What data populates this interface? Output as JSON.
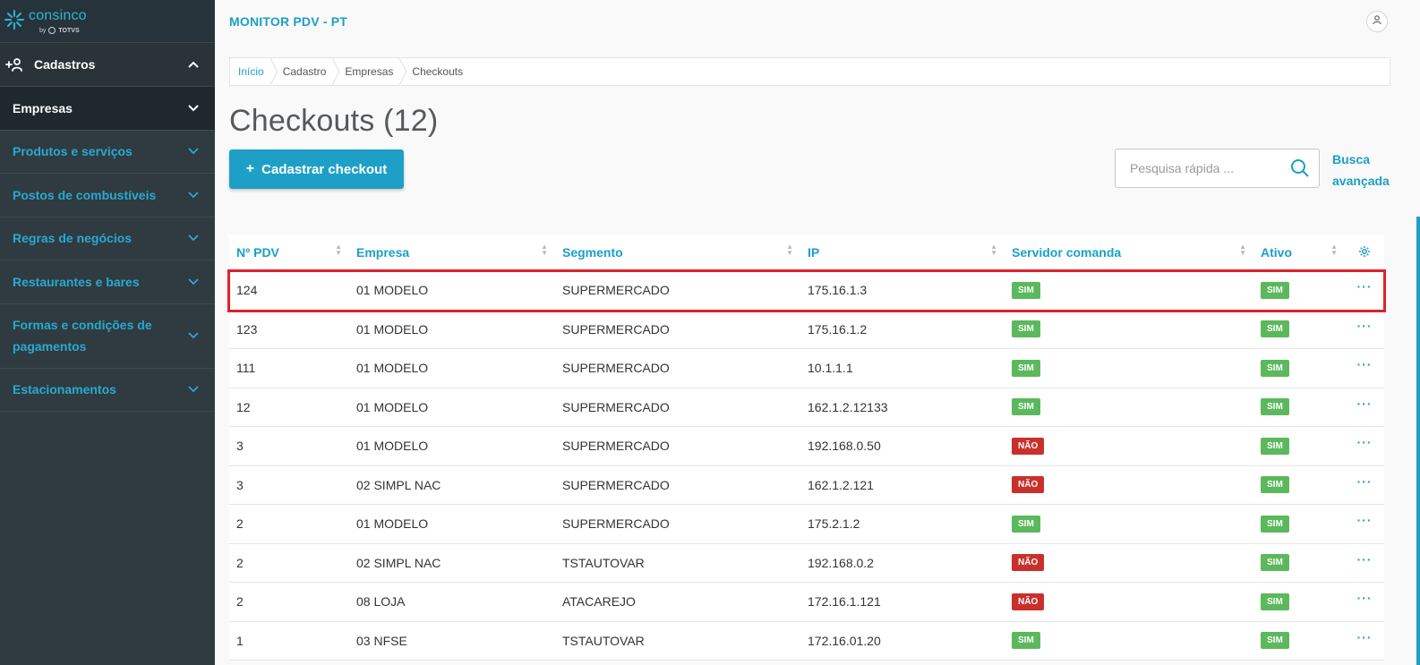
{
  "brand": {
    "name": "consinco",
    "by": "by",
    "partner": "TOTVS"
  },
  "sidebar": {
    "group": {
      "label": "Cadastros"
    },
    "items": [
      {
        "label": "Empresas",
        "active": true
      },
      {
        "label": "Produtos e serviços"
      },
      {
        "label": "Postos de combustíveis"
      },
      {
        "label": "Regras de negócios"
      },
      {
        "label": "Restaurantes e bares"
      },
      {
        "label": "Formas e condições de pagamentos"
      },
      {
        "label": "Estacionamentos"
      }
    ]
  },
  "header": {
    "app_title": "MONITOR PDV - PT"
  },
  "breadcrumb": [
    "Início",
    "Cadastro",
    "Empresas",
    "Checkouts"
  ],
  "page": {
    "title": "Checkouts (12)"
  },
  "actions": {
    "add_label": "Cadastrar checkout"
  },
  "search": {
    "placeholder": "Pesquisa rápida ...",
    "advanced_line1": "Busca",
    "advanced_line2": "avançada"
  },
  "table": {
    "columns": [
      "Nº PDV",
      "Empresa",
      "Segmento",
      "IP",
      "Servidor comanda",
      "Ativo"
    ],
    "rows": [
      {
        "pdv": "124",
        "empresa": "01 MODELO",
        "segmento": "SUPERMERCADO",
        "ip": "175.16.1.3",
        "servidor": "SIM",
        "ativo": "SIM"
      },
      {
        "pdv": "123",
        "empresa": "01 MODELO",
        "segmento": "SUPERMERCADO",
        "ip": "175.16.1.2",
        "servidor": "SIM",
        "ativo": "SIM"
      },
      {
        "pdv": "111",
        "empresa": "01 MODELO",
        "segmento": "SUPERMERCADO",
        "ip": "10.1.1.1",
        "servidor": "SIM",
        "ativo": "SIM"
      },
      {
        "pdv": "12",
        "empresa": "01 MODELO",
        "segmento": "SUPERMERCADO",
        "ip": "162.1.2.12133",
        "servidor": "SIM",
        "ativo": "SIM"
      },
      {
        "pdv": "3",
        "empresa": "01 MODELO",
        "segmento": "SUPERMERCADO",
        "ip": "192.168.0.50",
        "servidor": "NÃO",
        "ativo": "SIM"
      },
      {
        "pdv": "3",
        "empresa": "02 SIMPL NAC",
        "segmento": "SUPERMERCADO",
        "ip": "162.1.2.121",
        "servidor": "NÃO",
        "ativo": "SIM"
      },
      {
        "pdv": "2",
        "empresa": "01 MODELO",
        "segmento": "SUPERMERCADO",
        "ip": "175.2.1.2",
        "servidor": "SIM",
        "ativo": "SIM"
      },
      {
        "pdv": "2",
        "empresa": "02 SIMPL NAC",
        "segmento": "TSTAUTOVAR",
        "ip": "192.168.0.2",
        "servidor": "NÃO",
        "ativo": "SIM"
      },
      {
        "pdv": "2",
        "empresa": "08 LOJA",
        "segmento": "ATACAREJO",
        "ip": "172.16.1.121",
        "servidor": "NÃO",
        "ativo": "SIM"
      },
      {
        "pdv": "1",
        "empresa": "03 NFSE",
        "segmento": "TSTAUTOVAR",
        "ip": "172.16.01.20",
        "servidor": "SIM",
        "ativo": "SIM"
      }
    ],
    "row_menu": "···",
    "highlighted_row": 0
  },
  "colors": {
    "accent": "#1ea0c6",
    "sidebar_bg": "#2f3b40",
    "success": "#5cb85c",
    "danger": "#c9302c",
    "highlight": "#e0202a"
  },
  "icons": [
    "consinco-logo-icon",
    "add-user-icon",
    "chevron-up-icon",
    "chevron-down-icon",
    "user-icon",
    "search-icon",
    "gear-icon",
    "sort-icon",
    "more-icon"
  ]
}
